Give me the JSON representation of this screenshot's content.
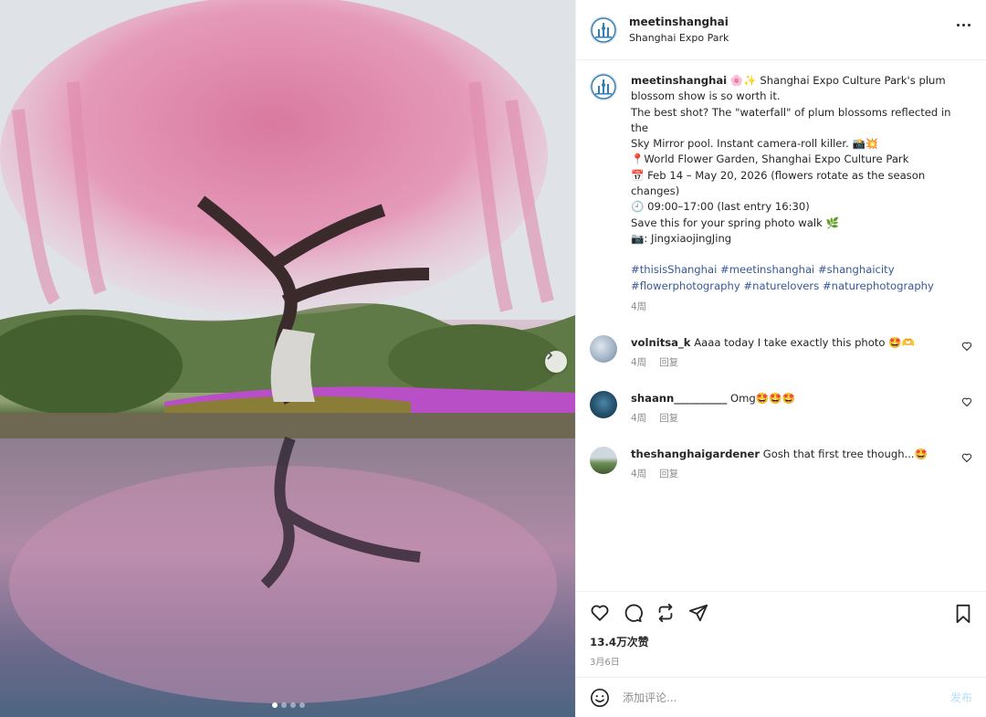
{
  "header": {
    "username": "meetinshanghai",
    "location": "Shanghai Expo Park"
  },
  "caption": {
    "username": "meetinshanghai",
    "lines": [
      "🌸✨ Shanghai Expo Culture Park's plum",
      "blossom show is so worth it.",
      "The best shot? The \"waterfall\" of plum blossoms reflected in the",
      "Sky Mirror pool. Instant camera-roll killer. 📸💥",
      "📍World Flower Garden, Shanghai Expo Culture Park",
      "📅 Feb 14 – May 20, 2026 (flowers rotate as the season changes)",
      "🕘 09:00–17:00 (last entry 16:30)",
      "Save this for your spring photo walk 🌿",
      "📷: JingxiaojingJing"
    ],
    "hashtags_line1": [
      "#thisisShanghai",
      "#meetinshanghai",
      "#shanghaicity"
    ],
    "hashtags_line2": [
      "#flowerphotography",
      "#naturelovers",
      "#naturephotography"
    ],
    "time": "4周"
  },
  "comments": [
    {
      "username": "volnitsa_k",
      "text": "Aaaa today I take exactly this photo 🤩🫶",
      "time": "4周",
      "reply": "回复"
    },
    {
      "username": "shaann__________",
      "text": "Omg🤩🤩🤩",
      "time": "4周",
      "reply": "回复"
    },
    {
      "username": "theshanghaigardener",
      "text": "Gosh that first tree though...🤩",
      "time": "4周",
      "reply": "回复"
    }
  ],
  "actions": {
    "likes": "13.4万次赞",
    "date": "3月6日"
  },
  "add_comment": {
    "placeholder": "添加评论...",
    "post_label": "发布"
  },
  "colors": {
    "hashtag": "#385898",
    "muted": "#8e8e8e",
    "post_button": "#b2dffc",
    "blossom": "#e89ab8"
  },
  "carousel": {
    "current": 1,
    "total": 4
  }
}
